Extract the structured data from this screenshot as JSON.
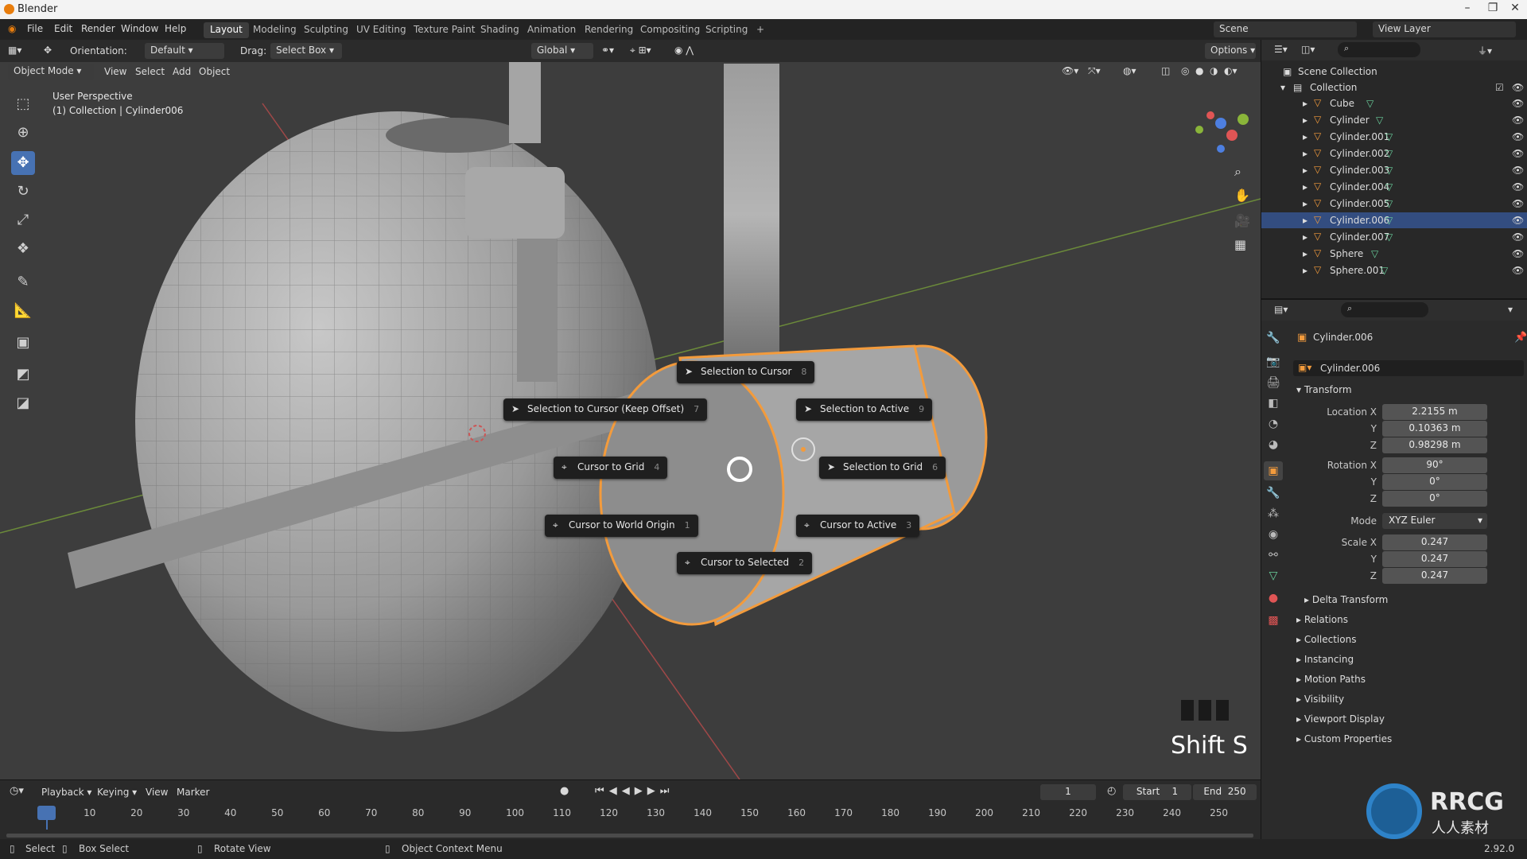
{
  "window": {
    "title": "Blender"
  },
  "menu": [
    "File",
    "Edit",
    "Render",
    "Window",
    "Help"
  ],
  "workspaces": [
    "Layout",
    "Modeling",
    "Sculpting",
    "UV Editing",
    "Texture Paint",
    "Shading",
    "Animation",
    "Rendering",
    "Compositing",
    "Scripting"
  ],
  "active_workspace": "Layout",
  "scene_name": "Scene",
  "view_layer": "View Layer",
  "tool_header": {
    "orientation_label": "Orientation:",
    "orientation_value": "Default",
    "drag_label": "Drag:",
    "drag_value": "Select Box",
    "transform_orientation": "Global",
    "options": "Options"
  },
  "viewport_header": {
    "mode": "Object Mode",
    "menus": [
      "View",
      "Select",
      "Add",
      "Object"
    ]
  },
  "viewport": {
    "perspective": "User Perspective",
    "context": "(1) Collection | Cylinder006",
    "key_hint": "Shift S"
  },
  "pie_menu": [
    {
      "label": "Selection to Cursor",
      "key": "8",
      "icon": "cursor-arrow-icon"
    },
    {
      "label": "Selection to Cursor (Keep Offset)",
      "key": "7",
      "icon": "cursor-arrow-icon"
    },
    {
      "label": "Selection to Active",
      "key": "9",
      "icon": "cursor-arrow-icon"
    },
    {
      "label": "Cursor to Grid",
      "key": "4",
      "icon": "3d-cursor-icon"
    },
    {
      "label": "Selection to Grid",
      "key": "6",
      "icon": "cursor-arrow-icon"
    },
    {
      "label": "Cursor to World Origin",
      "key": "1",
      "icon": "3d-cursor-icon"
    },
    {
      "label": "Cursor to Active",
      "key": "3",
      "icon": "3d-cursor-icon"
    },
    {
      "label": "Cursor to Selected",
      "key": "2",
      "icon": "3d-cursor-icon"
    }
  ],
  "outliner": {
    "root": "Scene Collection",
    "collection": "Collection",
    "items": [
      "Cube",
      "Cylinder",
      "Cylinder.001",
      "Cylinder.002",
      "Cylinder.003",
      "Cylinder.004",
      "Cylinder.005",
      "Cylinder.006",
      "Cylinder.007",
      "Sphere",
      "Sphere.001"
    ],
    "selected": "Cylinder.006"
  },
  "properties": {
    "object_name": "Cylinder.006",
    "object_field": "Cylinder.006",
    "transform_title": "Transform",
    "location": {
      "label": "Location X",
      "x": "2.2155 m",
      "y": "0.10363 m",
      "z": "0.98298 m"
    },
    "rotation": {
      "label": "Rotation X",
      "x": "90°",
      "y": "0°",
      "z": "0°"
    },
    "mode_label": "Mode",
    "mode_value": "XYZ Euler",
    "scale": {
      "label": "Scale X",
      "x": "0.247",
      "y": "0.247",
      "z": "0.247"
    },
    "axis_y": "Y",
    "axis_z": "Z",
    "delta": "Delta Transform",
    "sections": [
      "Relations",
      "Collections",
      "Instancing",
      "Motion Paths",
      "Visibility",
      "Viewport Display",
      "Custom Properties"
    ]
  },
  "timeline": {
    "menus": [
      "Playback",
      "Keying",
      "View",
      "Marker"
    ],
    "current_frame": "1",
    "start_label": "Start",
    "start_value": "1",
    "end_label": "End",
    "end_value": "250",
    "ticks": [
      "1",
      "10",
      "20",
      "30",
      "40",
      "50",
      "60",
      "70",
      "80",
      "90",
      "100",
      "110",
      "120",
      "130",
      "140",
      "150",
      "160",
      "170",
      "180",
      "190",
      "200",
      "210",
      "220",
      "230",
      "240",
      "250"
    ]
  },
  "statusbar": {
    "select": "Select",
    "box_select": "Box Select",
    "rotate_view": "Rotate View",
    "context_menu": "Object Context Menu",
    "version": "2.92.0"
  },
  "watermark": {
    "brand": "RRCG",
    "subtitle": "人人素材"
  },
  "colors": {
    "accent": "#4772b3",
    "selection": "#f39b3c",
    "outliner_selected": "#334d80"
  }
}
